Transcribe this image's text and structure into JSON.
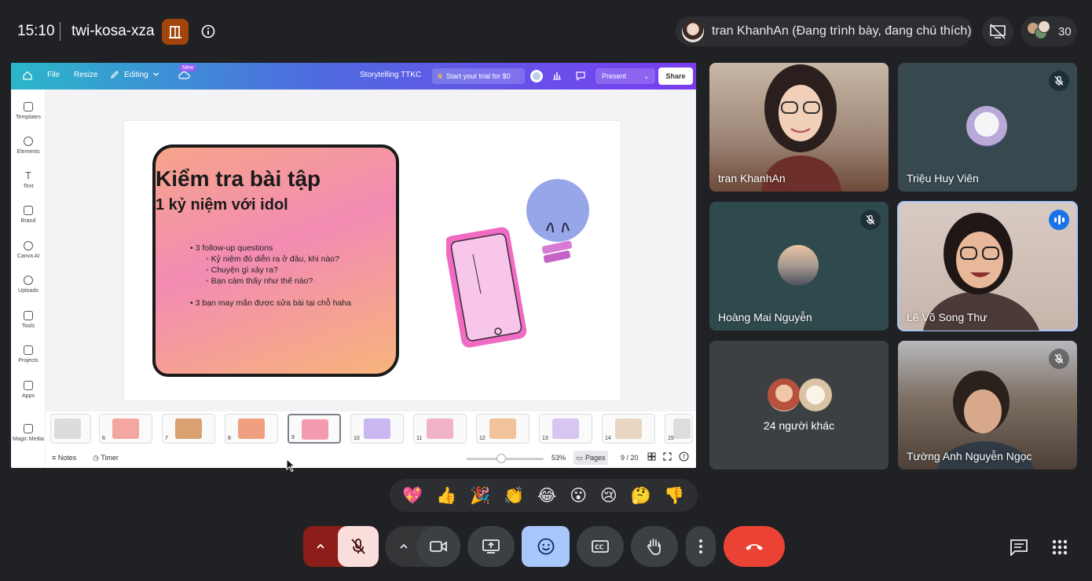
{
  "meeting": {
    "time": "15:10",
    "code": "twi-kosa-xza",
    "presenter_status": "tran KhanhAn (Đang trình bày, đang chú thích)",
    "participant_count": "30"
  },
  "canva": {
    "menu": {
      "file": "File",
      "resize": "Resize",
      "editing": "Editing",
      "new_badge": "New"
    },
    "doc_title": "Storytelling TTKC",
    "trial": "Start your trial for $0",
    "present": "Present",
    "share": "Share",
    "sidebar": [
      {
        "label": "Templates"
      },
      {
        "label": "Elements"
      },
      {
        "label": "Text"
      },
      {
        "label": "Brand"
      },
      {
        "label": "Canva AI"
      },
      {
        "label": "Uploads"
      },
      {
        "label": "Tools"
      },
      {
        "label": "Projects"
      },
      {
        "label": "Apps"
      },
      {
        "label": "Magic Media"
      }
    ],
    "slide": {
      "title": "Kiểm tra bài tập",
      "subtitle": "1 kỷ niệm với idol",
      "bullet1": "• 3 follow-up questions",
      "sub1": "◦ Kỷ niệm đó diễn ra ở đâu, khi nào?",
      "sub2": "◦ Chuyện gì xảy ra?",
      "sub3": "◦ Bạn cảm thấy như thế nào?",
      "bullet2": "• 3 bạn may mắn được sửa bài tại chỗ haha"
    },
    "thumbnails": [
      {
        "num": "6",
        "color": "#f4a6a0"
      },
      {
        "num": "7",
        "color": "#d9a070"
      },
      {
        "num": "8",
        "color": "#f0a080"
      },
      {
        "num": "9",
        "color": "#f59bb0"
      },
      {
        "num": "10",
        "color": "#c9b7f0"
      },
      {
        "num": "11",
        "color": "#f0b3c8"
      },
      {
        "num": "12",
        "color": "#f2c29a"
      },
      {
        "num": "13",
        "color": "#d7c6f2"
      },
      {
        "num": "14",
        "color": "#e8d6c2"
      },
      {
        "num": "15",
        "color": "#dddddd"
      }
    ],
    "bottom": {
      "notes": "Notes",
      "timer": "Timer",
      "zoom": "53%",
      "pages": "Pages",
      "page_counter": "9 / 20"
    }
  },
  "participants": [
    {
      "name": "tran KhanhAn"
    },
    {
      "name": "Triệu Huy Viên"
    },
    {
      "name": "Hoàng Mai Nguyễn"
    },
    {
      "name": "Lê Võ Song Thư"
    },
    {
      "name": "24 người khác"
    },
    {
      "name": "Tường Anh Nguyễn Ngọc"
    }
  ],
  "reactions": [
    "💖",
    "👍",
    "🎉",
    "👏",
    "😂",
    "😮",
    "😢",
    "🤔",
    "👎"
  ],
  "colors": {
    "background": "#202124",
    "end_call": "#ea4335",
    "active_speaker": "#1a73e8",
    "mic_muted": "#8c1d18",
    "reactions_active": "#a8c7fa"
  }
}
